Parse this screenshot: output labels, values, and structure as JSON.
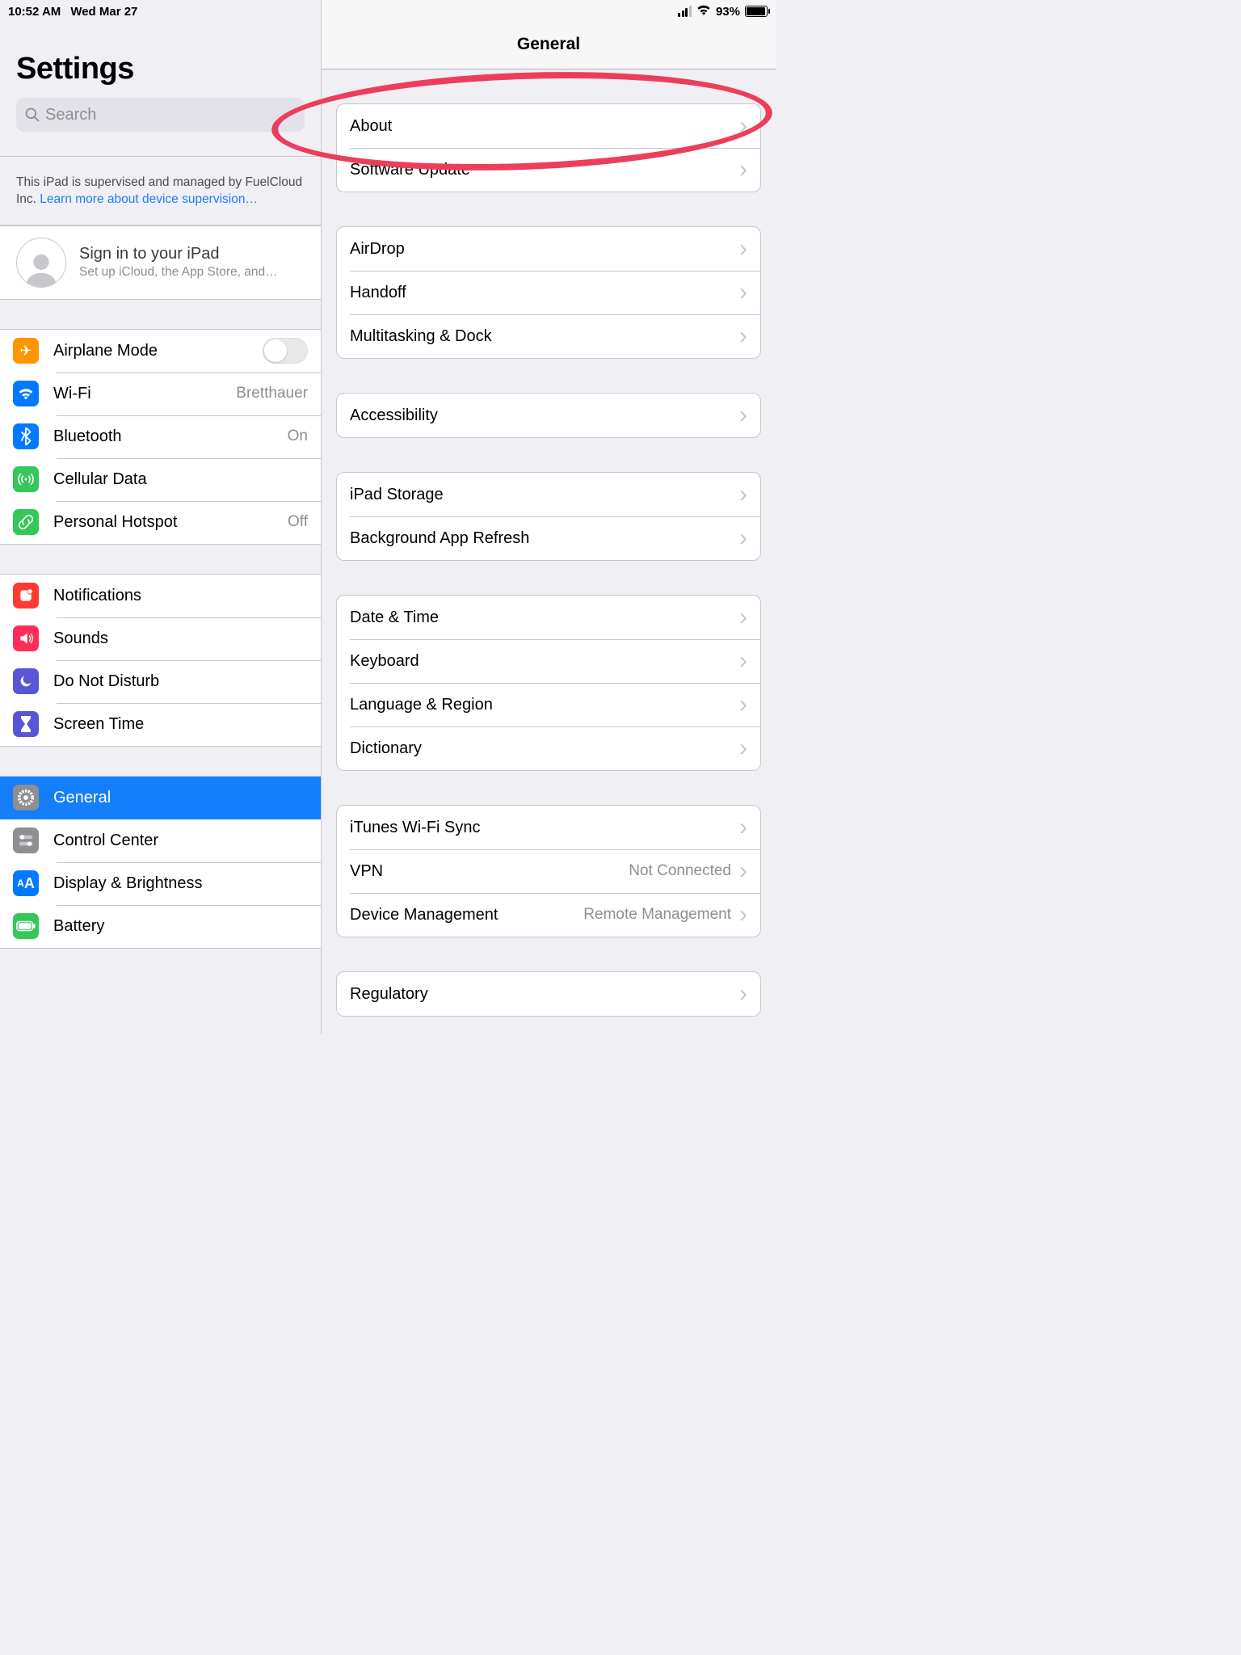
{
  "status": {
    "time": "10:52 AM",
    "date": "Wed Mar 27",
    "battery_pct": "93%"
  },
  "sidebar": {
    "title": "Settings",
    "search_placeholder": "Search",
    "supervision_note": "This iPad is supervised and managed by FuelCloud Inc. ",
    "supervision_link": "Learn more about device supervision…",
    "signin_title": "Sign in to your iPad",
    "signin_sub": "Set up iCloud, the App Store, and…",
    "g1": [
      {
        "label": "Airplane Mode",
        "icon": "airplane"
      },
      {
        "label": "Wi-Fi",
        "icon": "wifi",
        "value": "Bretthauer"
      },
      {
        "label": "Bluetooth",
        "icon": "bluetooth",
        "value": "On"
      },
      {
        "label": "Cellular Data",
        "icon": "antenna"
      },
      {
        "label": "Personal Hotspot",
        "icon": "link",
        "value": "Off"
      }
    ],
    "g2": [
      {
        "label": "Notifications",
        "icon": "bell"
      },
      {
        "label": "Sounds",
        "icon": "speaker"
      },
      {
        "label": "Do Not Disturb",
        "icon": "moon"
      },
      {
        "label": "Screen Time",
        "icon": "hourglass"
      }
    ],
    "g3": [
      {
        "label": "General",
        "icon": "gear"
      },
      {
        "label": "Control Center",
        "icon": "switches"
      },
      {
        "label": "Display & Brightness",
        "icon": "text"
      },
      {
        "label": "Battery",
        "icon": "battery"
      }
    ]
  },
  "detail": {
    "title": "General",
    "groups": [
      [
        {
          "label": "About"
        },
        {
          "label": "Software Update"
        }
      ],
      [
        {
          "label": "AirDrop"
        },
        {
          "label": "Handoff"
        },
        {
          "label": "Multitasking & Dock"
        }
      ],
      [
        {
          "label": "Accessibility"
        }
      ],
      [
        {
          "label": "iPad Storage"
        },
        {
          "label": "Background App Refresh"
        }
      ],
      [
        {
          "label": "Date & Time"
        },
        {
          "label": "Keyboard"
        },
        {
          "label": "Language & Region"
        },
        {
          "label": "Dictionary"
        }
      ],
      [
        {
          "label": "iTunes Wi-Fi Sync"
        },
        {
          "label": "VPN",
          "value": "Not Connected"
        },
        {
          "label": "Device Management",
          "value": "Remote Management"
        }
      ],
      [
        {
          "label": "Regulatory"
        }
      ]
    ]
  }
}
